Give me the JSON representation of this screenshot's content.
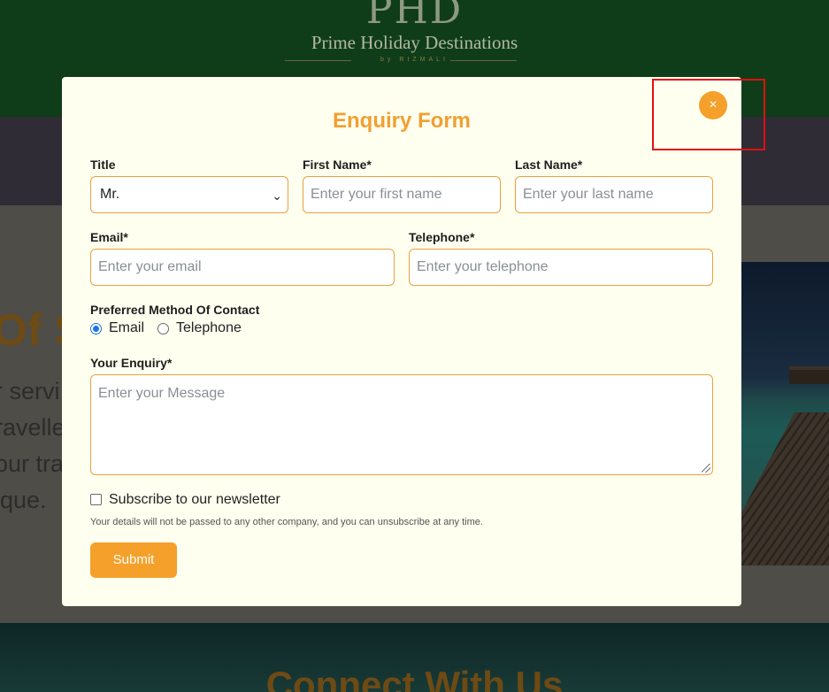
{
  "header": {
    "logo_mark": "PHD",
    "logo_name": "Prime Holiday Destinations",
    "logo_sub": "by RIZMALI"
  },
  "background": {
    "about_heading": "Of S",
    "about_text_lines": "r servi\nravelle\nour tra\nique.",
    "connect_title": "Connect With Us"
  },
  "modal": {
    "title": "Enquiry Form",
    "close_icon": "×",
    "fields": {
      "title": {
        "label": "Title",
        "value": "Mr."
      },
      "first_name": {
        "label": "First Name*",
        "placeholder": "Enter your first name"
      },
      "last_name": {
        "label": "Last Name*",
        "placeholder": "Enter your last name"
      },
      "email": {
        "label": "Email*",
        "placeholder": "Enter your email"
      },
      "telephone": {
        "label": "Telephone*",
        "placeholder": "Enter your telephone"
      },
      "contact_method": {
        "label": "Preferred Method Of Contact",
        "options": [
          "Email",
          "Telephone"
        ],
        "selected": "Email"
      },
      "enquiry": {
        "label": "Your Enquiry*",
        "placeholder": "Enter your Message"
      }
    },
    "newsletter": {
      "label": "Subscribe to our newsletter",
      "checked": false,
      "disclaimer": "Your details will not be passed to any other company, and you can unsubscribe at any time."
    },
    "submit_label": "Submit"
  },
  "colors": {
    "accent": "#f5a02a",
    "modal_bg": "#fffff0",
    "input_border": "#e8a23c",
    "highlight": "#e01010"
  }
}
